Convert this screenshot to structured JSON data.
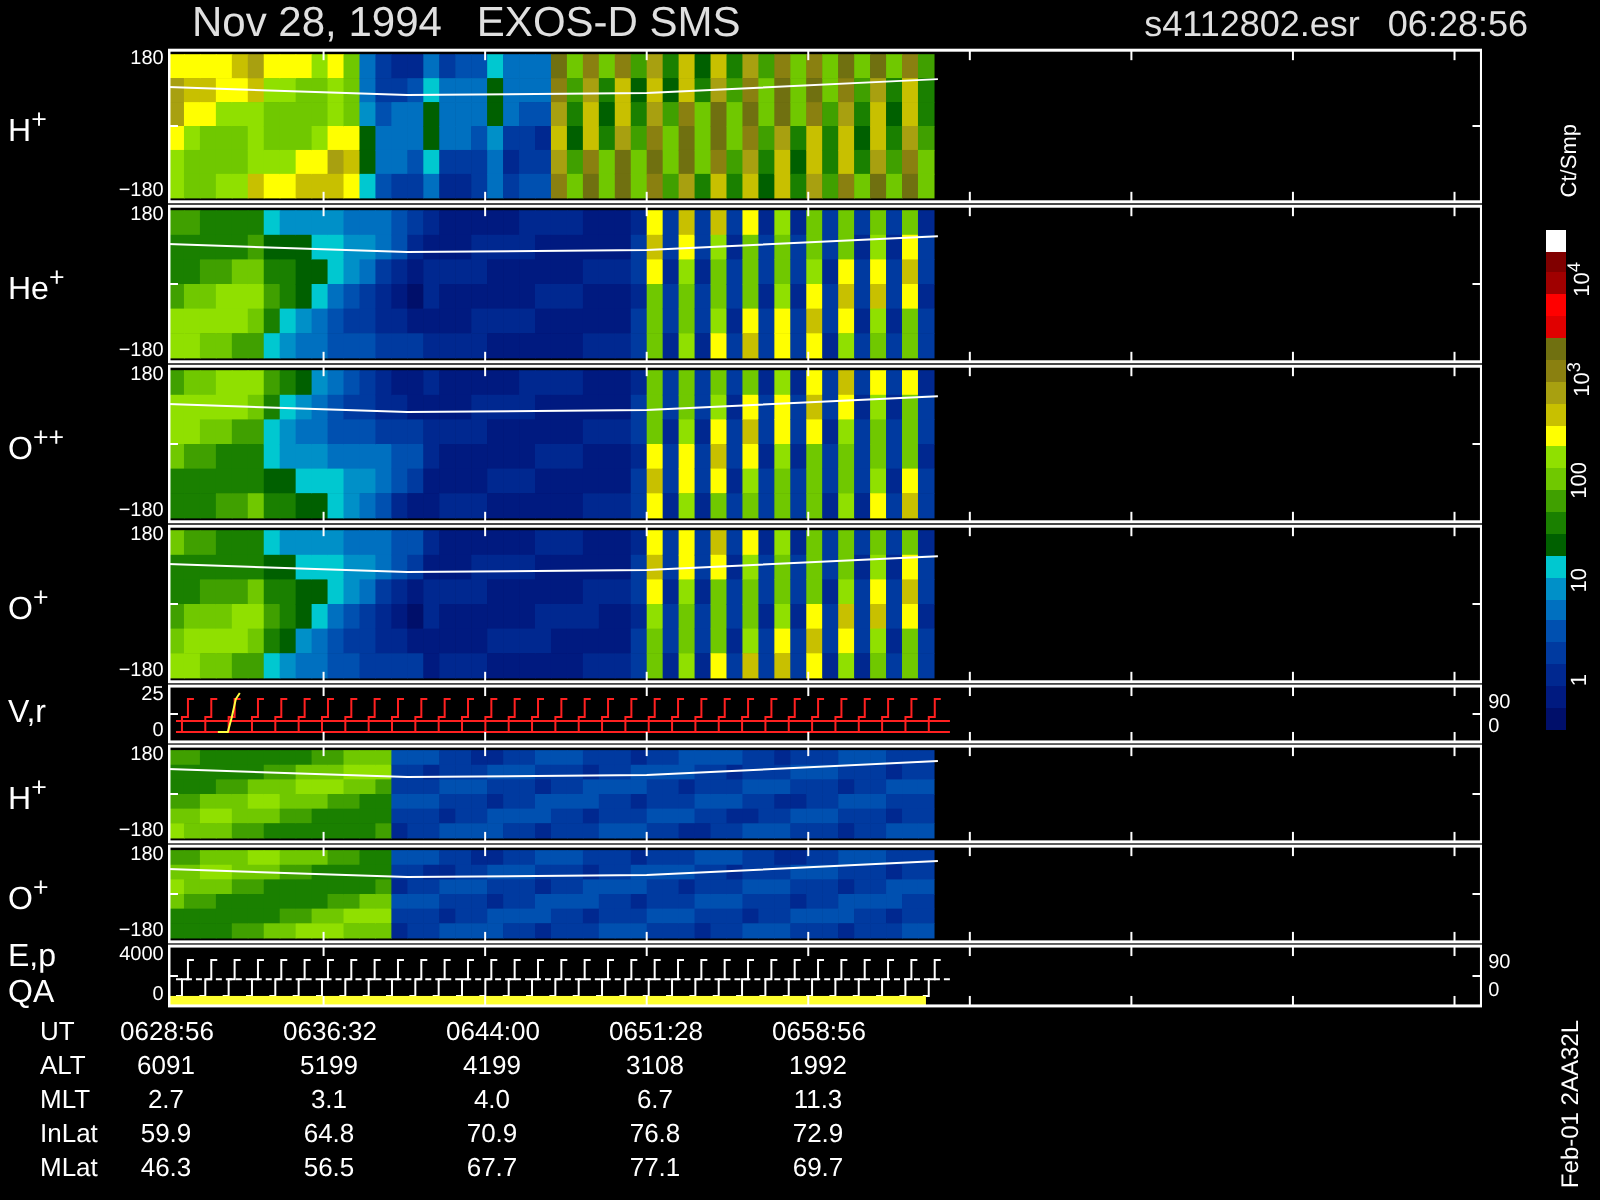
{
  "header": {
    "title": "Nov 28, 1994   EXOS-D SMS",
    "file": "s4112802.esr",
    "time": "06:28:56"
  },
  "panels": [
    {
      "kind": "spectrogram",
      "label": "H$^{+}$",
      "ticks": [
        "180",
        "−180"
      ]
    },
    {
      "kind": "spectrogram",
      "label": "He$^{+}$",
      "ticks": [
        "180",
        "−180"
      ]
    },
    {
      "kind": "spectrogram",
      "label": "O$^{++}$",
      "ticks": [
        "180",
        "−180"
      ]
    },
    {
      "kind": "spectrogram",
      "label": "O$^{+}$",
      "ticks": [
        "180",
        "−180"
      ]
    },
    {
      "kind": "velocity",
      "label": "V,r",
      "ticks": [
        "25",
        "0"
      ],
      "right_ticks": [
        "90",
        "0"
      ]
    },
    {
      "kind": "spectrogram",
      "label": "H$^{+}$",
      "ticks": [
        "180",
        "−180"
      ]
    },
    {
      "kind": "spectrogram",
      "label": "O$^{+}$",
      "ticks": [
        "180",
        "−180"
      ]
    },
    {
      "kind": "energy",
      "label": "E,p",
      "label2": "QA",
      "ticks": [
        "4000",
        "0"
      ],
      "right_ticks": [
        "90",
        "0"
      ]
    }
  ],
  "colorbar": {
    "unit": "Ct/Smp",
    "labels": [
      "10$^{4}$",
      "10$^{3}$",
      "100",
      "10",
      "1"
    ]
  },
  "table": [
    {
      "label": "UT",
      "values": [
        "0628:56",
        "0636:32",
        "0644:00",
        "0651:28",
        "0658:56"
      ]
    },
    {
      "label": "ALT",
      "values": [
        "6091",
        "5199",
        "4199",
        "3108",
        "1992"
      ]
    },
    {
      "label": "MLT",
      "values": [
        "2.7",
        "3.1",
        "4.0",
        "6.7",
        "11.3"
      ]
    },
    {
      "label": "InLat",
      "values": [
        "59.9",
        "64.8",
        "70.9",
        "76.8",
        "72.9"
      ]
    },
    {
      "label": "MLat",
      "values": [
        "46.3",
        "56.5",
        "67.7",
        "77.1",
        "69.7"
      ]
    }
  ],
  "footer": "Feb-01 2AA32L"
}
